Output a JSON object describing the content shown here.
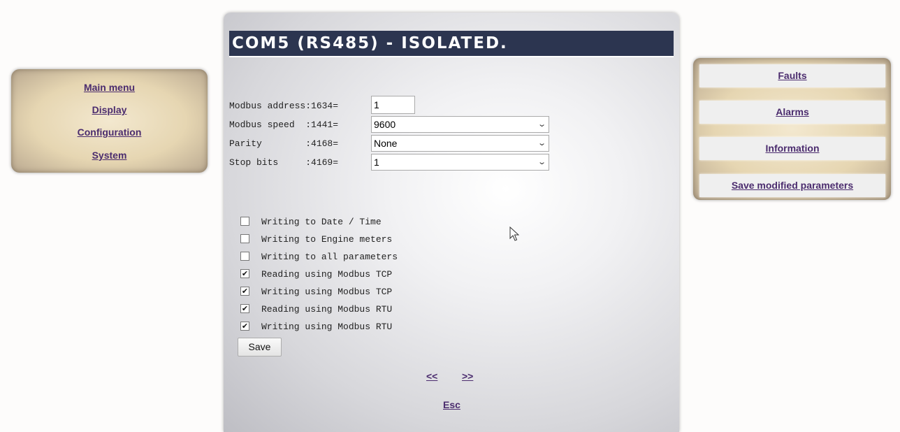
{
  "left_menu": {
    "items": [
      {
        "label": "Main menu"
      },
      {
        "label": "Display"
      },
      {
        "label": "Configuration"
      },
      {
        "label": "System"
      }
    ]
  },
  "main": {
    "title": "COM5 (RS485) - ISOLATED.",
    "modbus_address": {
      "label": "Modbus address:1634=",
      "value": "1"
    },
    "modbus_speed": {
      "label": "Modbus speed  :1441=",
      "selected": "9600"
    },
    "parity": {
      "label": "Parity        :4168=",
      "selected": "None"
    },
    "stop_bits": {
      "label": "Stop bits     :4169=",
      "selected": "1"
    },
    "checkboxes": [
      {
        "label": "Writing to Date / Time",
        "checked": false
      },
      {
        "label": "Writing to Engine meters",
        "checked": false
      },
      {
        "label": "Writing to all parameters",
        "checked": false
      },
      {
        "label": "Reading using Modbus TCP",
        "checked": true
      },
      {
        "label": "Writing using Modbus TCP",
        "checked": true
      },
      {
        "label": "Reading using Modbus RTU",
        "checked": true
      },
      {
        "label": "Writing using Modbus RTU",
        "checked": true
      }
    ],
    "save_label": "Save",
    "prev_label": "<<",
    "next_label": ">>",
    "esc_label": "Esc"
  },
  "right_menu": {
    "items": [
      {
        "label": "Faults"
      },
      {
        "label": "Alarms"
      },
      {
        "label": "Information"
      },
      {
        "label": "Save modified parameters"
      }
    ]
  },
  "colors": {
    "title_bar": "#2c3550",
    "link": "#4b2c6e",
    "panel_beige": "#e6d6b2"
  },
  "icons": {
    "dropdown": "chevron-down-icon",
    "check": "checkmark-icon",
    "cursor": "mouse-pointer-icon"
  }
}
